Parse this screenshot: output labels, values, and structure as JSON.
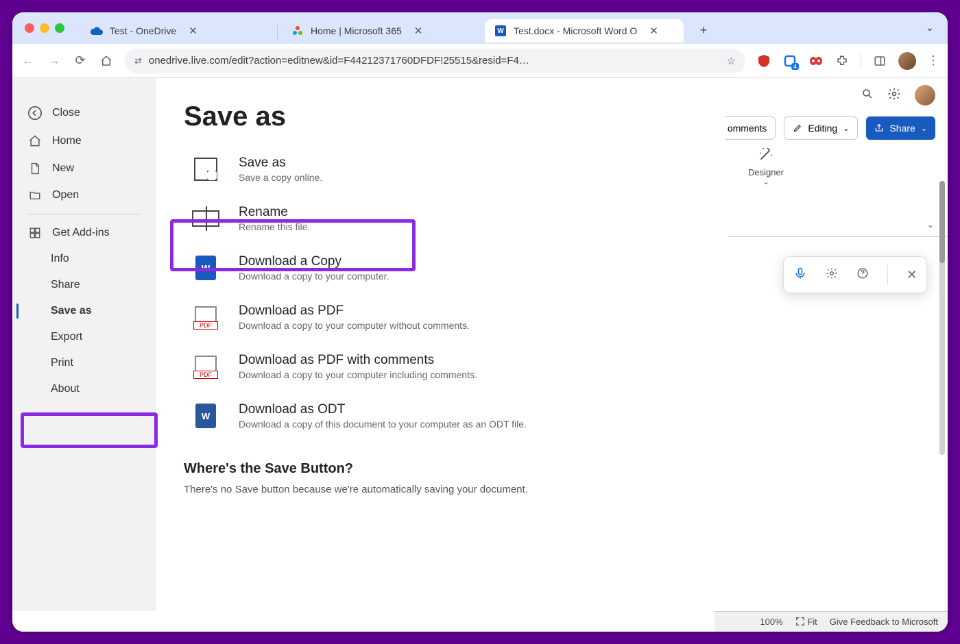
{
  "browser": {
    "tabs": [
      {
        "title": "Test - OneDrive"
      },
      {
        "title": "Home | Microsoft 365"
      },
      {
        "title": "Test.docx - Microsoft Word O"
      }
    ],
    "url": "onedrive.live.com/edit?action=editnew&id=F44212371760DFDF!25515&resid=F4…",
    "ext_badge": "4"
  },
  "word": {
    "comments": "omments",
    "editing": "Editing",
    "share": "Share",
    "designer": "Designer",
    "zoom": "100%",
    "fit": "Fit",
    "feedback": "Give Feedback to Microsoft"
  },
  "file": {
    "title": "Save as",
    "sidebar": {
      "close": "Close",
      "home": "Home",
      "new": "New",
      "open": "Open",
      "addins": "Get Add-ins",
      "info": "Info",
      "share": "Share",
      "saveas": "Save as",
      "export": "Export",
      "print": "Print",
      "about": "About"
    },
    "options": [
      {
        "title": "Save as",
        "sub": "Save a copy online."
      },
      {
        "title": "Rename",
        "sub": "Rename this file."
      },
      {
        "title": "Download a Copy",
        "sub": "Download a copy to your computer."
      },
      {
        "title": "Download as PDF",
        "sub": "Download a copy to your computer without comments."
      },
      {
        "title": "Download as PDF with comments",
        "sub": "Download a copy to your computer including comments."
      },
      {
        "title": "Download as ODT",
        "sub": "Download a copy of this document to your computer as an ODT file."
      }
    ],
    "info_head": "Where's the Save Button?",
    "info_body": "There's no Save button because we're automatically saving your document."
  }
}
